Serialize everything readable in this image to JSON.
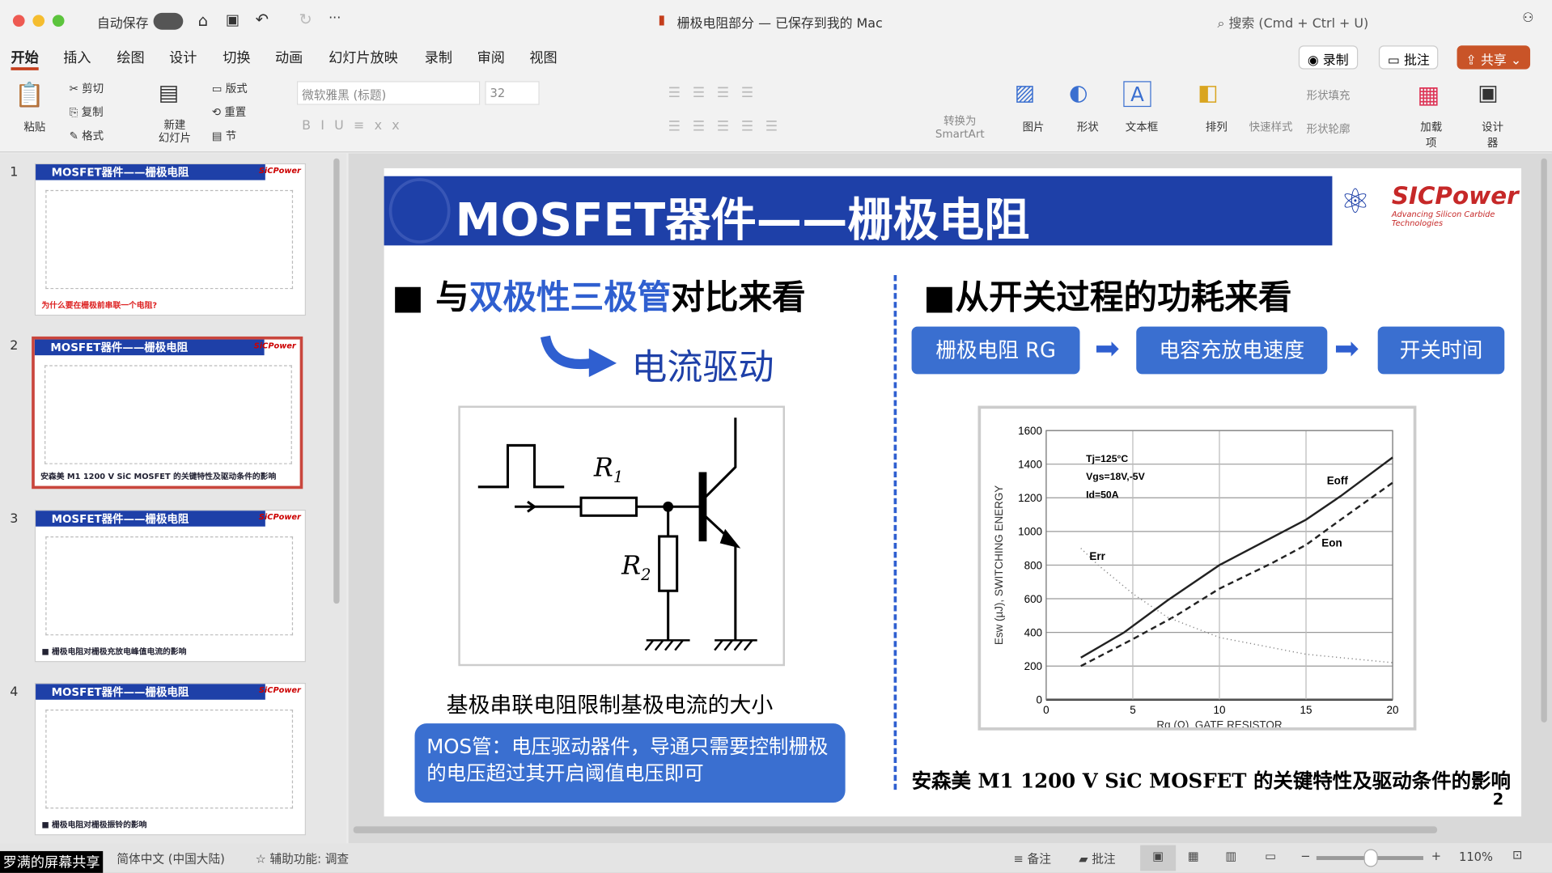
{
  "window": {
    "title": "栅极电阻部分 — 已保存到我的 Mac",
    "autosave": "自动保存",
    "search_placeholder": "搜索 (Cmd + Ctrl + U)"
  },
  "tabs": [
    "开始",
    "插入",
    "绘图",
    "设计",
    "切换",
    "动画",
    "幻灯片放映",
    "录制",
    "审阅",
    "视图"
  ],
  "actions": {
    "record": "录制",
    "comment": "批注",
    "share": "共享"
  },
  "ribbon": {
    "paste": "粘贴",
    "cut": "剪切",
    "copy": "复制",
    "format": "格式",
    "new_slide": "新建\n幻灯片",
    "layout": "版式",
    "reset": "重置",
    "section": "节",
    "font": "微软雅黑 (标题)",
    "size": "32",
    "smartart": "转换为\nSmartArt",
    "picture": "图片",
    "shape": "形状",
    "textbox": "文本框",
    "arrange": "排列",
    "quick_style": "快速样式",
    "shape_fill": "形状填充",
    "shape_outline": "形状轮廓",
    "addins": "加载项",
    "designer": "设计器"
  },
  "thumbs": [
    {
      "num": "1",
      "title": "MOSFET器件——栅极电阻",
      "caption": "为什么要在栅极前串联一个电阻?"
    },
    {
      "num": "2",
      "title": "MOSFET器件——栅极电阻",
      "caption": "安森美 M1 1200 V SiC MOSFET 的关键特性及驱动条件的影响"
    },
    {
      "num": "3",
      "title": "MOSFET器件——栅极电阻",
      "caption": "■ 栅极电阻对栅极充放电峰值电流的影响"
    },
    {
      "num": "4",
      "title": "MOSFET器件——栅极电阻",
      "caption": "■ 栅极电阻对栅极振铃的影响"
    }
  ],
  "thumb_logo": "SiCPower",
  "slide": {
    "title": "MOSFET器件——栅极电阻",
    "logo": "SICPower",
    "logo_sub": "Advancing Silicon Carbide Technologies",
    "left_heading_pre": "■ 与",
    "left_heading_hl": "双极性三极管",
    "left_heading_post": "对比来看",
    "current_drive": "电流驱动",
    "r1": "R",
    "r1_sub": "1",
    "r2": "R",
    "r2_sub": "2",
    "base_caption": "基极串联电阻限制基极电流的大小",
    "mos_note": "MOS管：电压驱动器件，导通只需要控制栅极的电压超过其开启阈值电压即可",
    "right_heading": "■从开关过程的功耗来看",
    "flow": [
      "栅极电阻 RG",
      "电容充放电速度",
      "开关时间"
    ],
    "footer": "安森美 M1 1200 V SiC MOSFET 的关键特性及驱动条件的影响",
    "page": "2"
  },
  "chart_data": {
    "type": "line",
    "xlabel": "Rg (Ω), GATE RESISTOR",
    "ylabel": "Esw (µJ), SWITCHING ENERGY",
    "xlim": [
      0,
      20
    ],
    "ylim": [
      0,
      1600
    ],
    "xticks": [
      0,
      5,
      10,
      15,
      20
    ],
    "yticks": [
      0,
      200,
      400,
      600,
      800,
      1000,
      1200,
      1400,
      1600
    ],
    "grid": true,
    "conditions": [
      "Tj=125°C",
      "Vgs=18V,-5V",
      "Id=50A"
    ],
    "series": [
      {
        "name": "Eoff",
        "style": "solid",
        "x": [
          2,
          4.5,
          7,
          10,
          15,
          17,
          20
        ],
        "y": [
          250,
          400,
          590,
          800,
          1070,
          1210,
          1440
        ]
      },
      {
        "name": "Eon",
        "style": "dashed",
        "x": [
          2,
          5,
          7.5,
          10,
          13,
          15,
          17,
          20
        ],
        "y": [
          200,
          360,
          500,
          660,
          810,
          920,
          1070,
          1290
        ]
      },
      {
        "name": "Err",
        "style": "dotted",
        "x": [
          2,
          3,
          5,
          7,
          10,
          15,
          20
        ],
        "y": [
          900,
          800,
          630,
          490,
          370,
          270,
          220
        ]
      }
    ]
  },
  "status": {
    "lang": "简体中文 (中国大陆)",
    "accessibility": "辅助功能: 调查",
    "notes": "备注",
    "comments": "批注",
    "zoom": "110%",
    "overlay": "罗满的屏幕共享"
  }
}
